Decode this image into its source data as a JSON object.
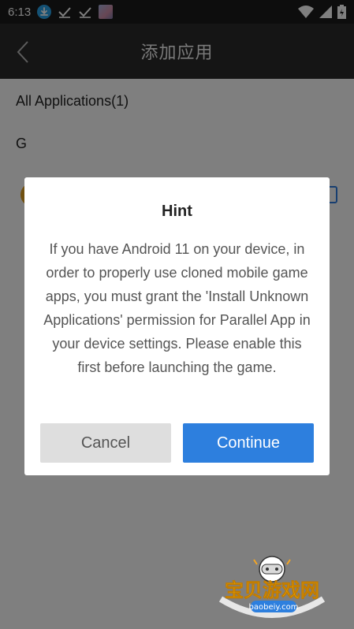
{
  "status_bar": {
    "time": "6:13"
  },
  "toolbar": {
    "title": "添加应用"
  },
  "content": {
    "section_header": "All Applications(1)",
    "group_letter": "G"
  },
  "dialog": {
    "title": "Hint",
    "message": "If you have Android 11 on your device, in order to properly use cloned mobile game apps, you must grant the 'Install Unknown Applications' permission for Parallel App in your device settings. Please enable this first before launching the game.",
    "cancel_label": "Cancel",
    "continue_label": "Continue"
  },
  "watermark": {
    "brand": "宝贝游戏网",
    "domain": "baobeiy.com"
  },
  "colors": {
    "accent": "#2d7fde",
    "toolbar_bg": "#2b2b2b",
    "status_bg": "#1a1a1a"
  }
}
